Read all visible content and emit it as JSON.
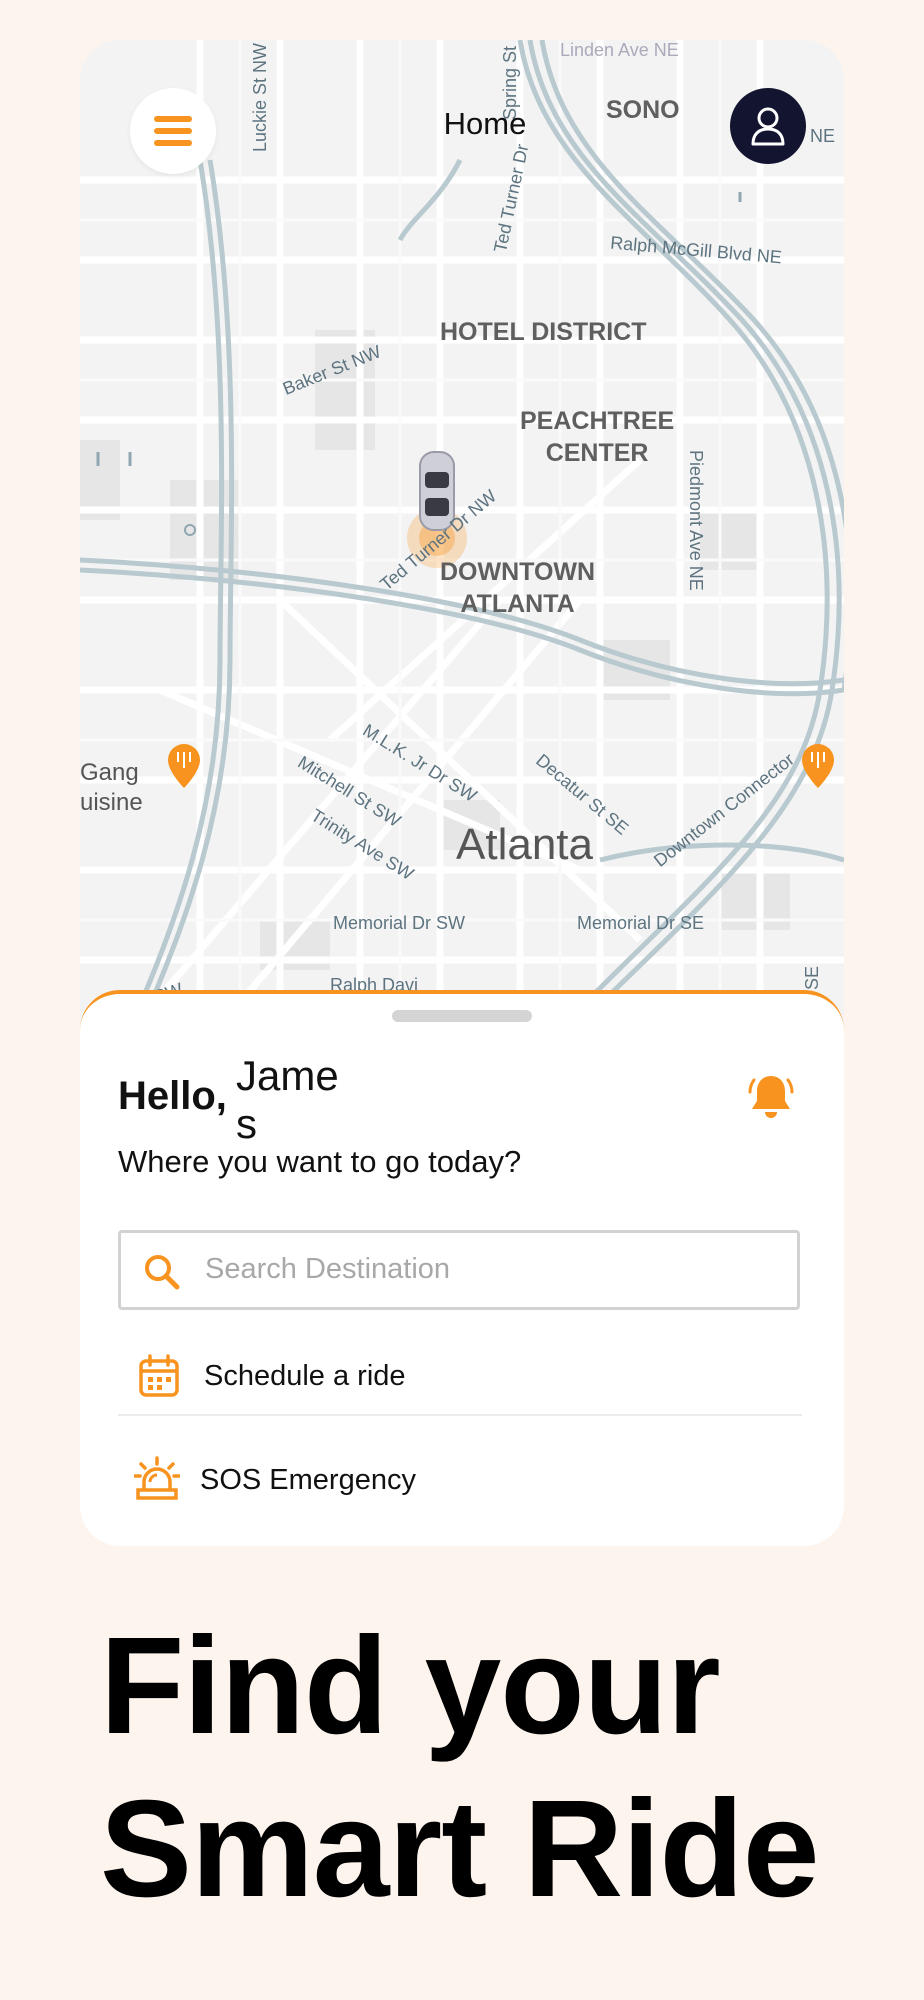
{
  "header": {
    "title": "Home"
  },
  "map": {
    "districts": [
      "SONO",
      "HOTEL DISTRICT",
      "PEACHTREE\nCENTER",
      "DOWNTOWN\nATLANTA"
    ],
    "city": "Atlanta",
    "streets": [
      "Luckie St NW",
      "Spring St",
      "Ted Turner Dr",
      "Ralph McGill Blvd NE",
      "Baker St NW",
      "Piedmont Ave NE",
      "Ted Turner Dr NW",
      "Decatur St SE",
      "M.L.K. Jr Dr SW",
      "Mitchell St SW",
      "Trinity Ave SW",
      "Downtown Connector",
      "Memorial Dr SW",
      "Memorial Dr SE",
      "Gang\nuisine",
      "NE",
      "Linden Ave NE",
      "ell St SW",
      "Ralph Davi",
      "t SE"
    ]
  },
  "sheet": {
    "greeting": "Hello,",
    "user_name": "James",
    "subtitle": "Where you want to go today?",
    "search": {
      "placeholder": "Search Destination",
      "value": ""
    },
    "actions": [
      {
        "label": "Schedule a ride",
        "icon": "calendar-icon"
      },
      {
        "label": "SOS Emergency",
        "icon": "siren-icon"
      }
    ]
  },
  "headline": "Find your\nSmart Ride",
  "colors": {
    "accent": "#f7931e",
    "dark": "#121430",
    "background": "#fdf4ee"
  }
}
